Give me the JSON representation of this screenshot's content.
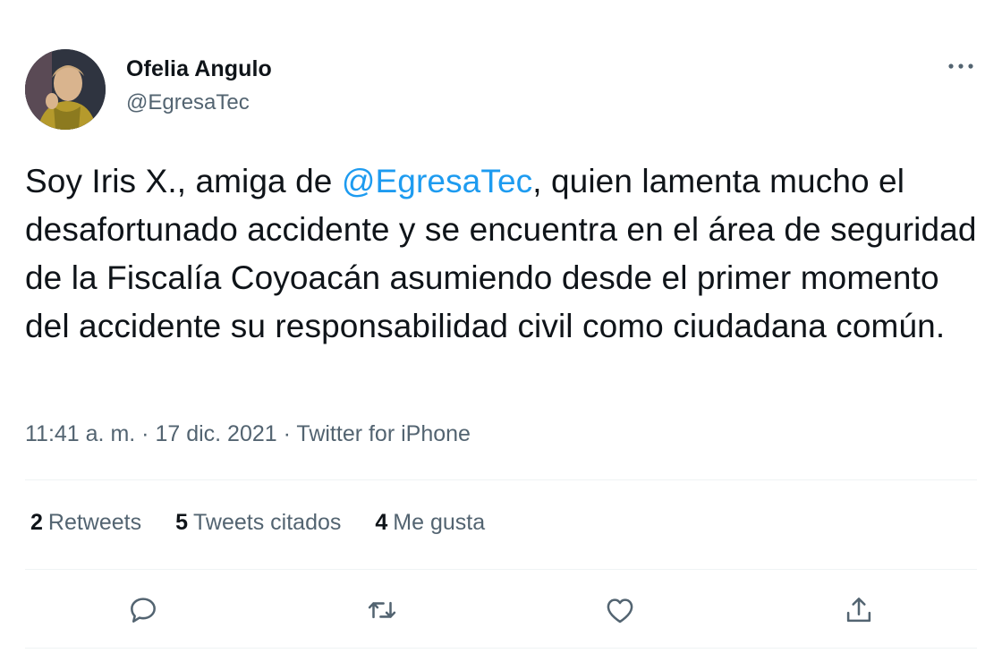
{
  "author": {
    "name": "Ofelia Angulo",
    "handle": "@EgresaTec"
  },
  "tweet": {
    "text_part1": "Soy Iris X., amiga de ",
    "mention": "@EgresaTec",
    "text_part2": ", quien lamenta mucho el desafortunado accidente y se encuentra en el área de seguridad de la Fiscalía Coyoacán asumiendo desde el primer momento del accidente su responsabilidad civil como ciudadana común."
  },
  "meta": {
    "time": "11:41 a. m.",
    "separator": " · ",
    "date": "17 dic. 2021",
    "source": "Twitter for iPhone"
  },
  "stats": {
    "retweets_count": "2",
    "retweets_label": "Retweets",
    "quotes_count": "5",
    "quotes_label": "Tweets citados",
    "likes_count": "4",
    "likes_label": "Me gusta"
  },
  "icons": {
    "more": "more-horizontal-icon",
    "reply": "reply-icon",
    "retweet": "retweet-icon",
    "like": "heart-icon",
    "share": "share-icon"
  },
  "colors": {
    "accent": "#1d9bf0",
    "secondary_text": "#536471",
    "primary_text": "#0f1419",
    "divider": "#eff3f4"
  }
}
